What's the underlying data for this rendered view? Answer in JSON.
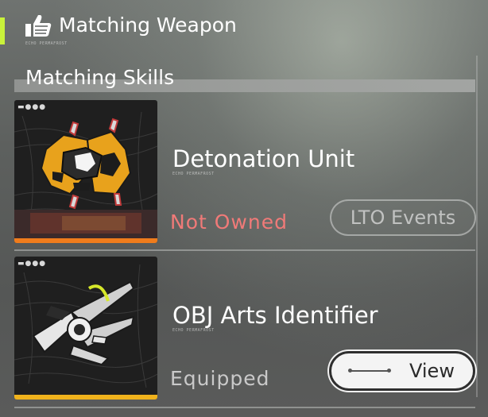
{
  "header": {
    "title": "Matching Weapon",
    "icon": "thumbs-up-icon",
    "caption": "ECHO PERMAFROST"
  },
  "section": {
    "title": "Matching Skills"
  },
  "items": [
    {
      "name": "Detonation Unit",
      "caption": "ECHO PERMAFROST",
      "status": "Not Owned",
      "action_label": "LTO Events",
      "thumb_icon": "detonation-unit-icon",
      "thumb_dots": "▬●●●",
      "status_color": "#f07a78",
      "bar_color": "#f07c1c"
    },
    {
      "name": "OBJ Arts Identifier",
      "caption": "ECHO PERMAFROST",
      "status": "Equipped",
      "action_label": "View",
      "thumb_icon": "arts-identifier-icon",
      "thumb_dots": "▬●●●",
      "status_color": "#c9c9c9",
      "bar_color": "#f0b21c"
    }
  ],
  "colors": {
    "accent": "#c9f23a",
    "not_owned": "#f07a78",
    "rarity_orange": "#f07c1c",
    "rarity_gold": "#f0b21c"
  }
}
